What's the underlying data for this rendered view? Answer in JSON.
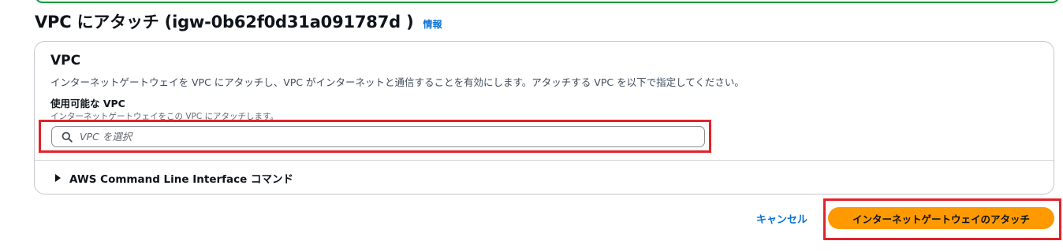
{
  "page": {
    "title": "VPC にアタッチ (igw-0b62f0d31a091787d )",
    "info_link": "情報"
  },
  "vpc_section": {
    "title": "VPC",
    "description": "インターネットゲートウェイを VPC にアタッチし、VPC がインターネットと通信することを有効にします。アタッチする VPC を以下で指定してください。",
    "field_label": "使用可能な VPC",
    "field_description": "インターネットゲートウェイをこの VPC にアタッチします。",
    "search": {
      "placeholder": "VPC を選択",
      "value": "",
      "icon": "search-icon"
    }
  },
  "cli_section": {
    "label": "AWS Command Line Interface コマンド",
    "icon": "caret-right-icon"
  },
  "actions": {
    "cancel_label": "キャンセル",
    "primary_label": "インターネットゲートウェイのアタッチ"
  },
  "colors": {
    "primary_button": "#ff9900",
    "link": "#0972d3",
    "highlight": "#e0232a",
    "banner_border": "#0f9a3d"
  }
}
